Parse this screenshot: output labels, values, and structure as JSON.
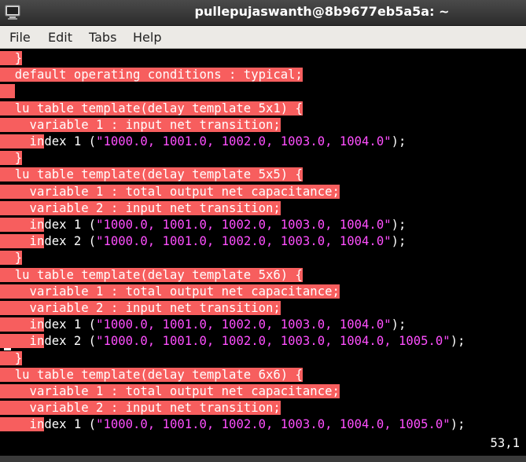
{
  "window": {
    "title": "pullepujaswanth@8b9677eb5a5a: ~"
  },
  "menu": {
    "file": "File",
    "edit": "Edit",
    "tabs": "Tabs",
    "help": "Help"
  },
  "terminal": {
    "lines": [
      {
        "hl": "  }"
      },
      {
        "hl": "  default operating conditions : typical;"
      },
      {
        "hl": "  "
      },
      {
        "hl": "  lu table template(delay template 5x1) {"
      },
      {
        "hl": "    variable 1 : input net transition;"
      },
      {
        "hl": "    in",
        "lt": "dex 1 (",
        "str": "\"1000.0, 1001.0, 1002.0, 1003.0, 1004.0\"",
        "end": ");"
      },
      {
        "hl": "  }"
      },
      {
        "hl": "  lu table template(delay template 5x5) {"
      },
      {
        "hl": "    variable 1 : total output net capacitance;"
      },
      {
        "hl": "    variable 2 : input net transition;"
      },
      {
        "hl": "    in",
        "lt": "dex 1 (",
        "str": "\"1000.0, 1001.0, 1002.0, 1003.0, 1004.0\"",
        "end": ");"
      },
      {
        "hl": "    in",
        "lt": "dex 2 (",
        "str": "\"1000.0, 1001.0, 1002.0, 1003.0, 1004.0\"",
        "end": ");"
      },
      {
        "hl": "  }"
      },
      {
        "hl": "  lu table template(delay template 5x6) {"
      },
      {
        "hl": "    variable 1 : total output net capacitance;"
      },
      {
        "hl": "    variable 2 : input net transition;"
      },
      {
        "hl": "    in",
        "lt": "dex 1 (",
        "str": "\"1000.0, 1001.0, 1002.0, 1003.0, 1004.0\"",
        "end": ");"
      },
      {
        "hl": "    in",
        "lt": "dex 2 (",
        "str": "\"1000.0, 1001.0, 1002.0, 1003.0, 1004.0, 1005.0\"",
        "end": ");"
      },
      {
        "hl": "  }"
      },
      {
        "hl": "  lu table template(delay template 6x6) {"
      },
      {
        "hl": "    variable 1 : total output net capacitance;"
      },
      {
        "hl": "    variable 2 : input net transition;"
      },
      {
        "hl": "    in",
        "lt": "dex 1 (",
        "str": "\"1000.0, 1001.0, 1002.0, 1003.0, 1004.0, 1005.0\"",
        "end": ");"
      }
    ],
    "status": "53,1"
  },
  "colors": {
    "highlight": "#f75e5e",
    "string": "#ff4fff",
    "text": "#ffffff",
    "background": "#000000"
  },
  "icons": {
    "window_icon": "terminal-icon"
  }
}
